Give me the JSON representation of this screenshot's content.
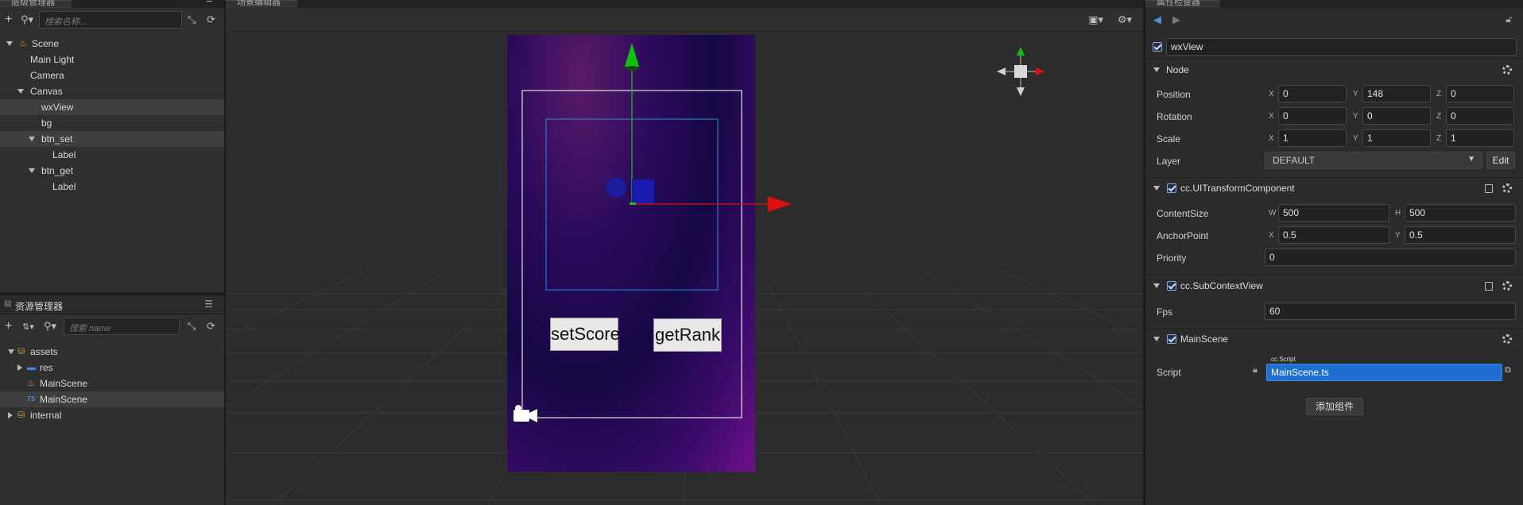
{
  "hierarchy": {
    "title": "层级管理器",
    "search_placeholder": "搜索名称...",
    "nodes": [
      {
        "label": "Scene",
        "icon": "scene-flame-icon",
        "expanded": true,
        "depth": 0
      },
      {
        "label": "Main Light",
        "depth": 1
      },
      {
        "label": "Camera",
        "depth": 1
      },
      {
        "label": "Canvas",
        "expanded": true,
        "depth": 1
      },
      {
        "label": "wxView",
        "depth": 2,
        "selected": true
      },
      {
        "label": "bg",
        "depth": 2
      },
      {
        "label": "btn_set",
        "expanded": true,
        "depth": 2,
        "highlight": true
      },
      {
        "label": "Label",
        "depth": 3
      },
      {
        "label": "btn_get",
        "expanded": true,
        "depth": 2
      },
      {
        "label": "Label",
        "depth": 3
      }
    ]
  },
  "assets": {
    "title": "资源管理器",
    "search_placeholder": "搜索 name",
    "nodes": [
      {
        "label": "assets",
        "icon": "database-icon",
        "expanded": true
      },
      {
        "label": "res",
        "icon": "folder-icon"
      },
      {
        "label": "MainScene",
        "icon": "scene-flame-icon"
      },
      {
        "label": "MainScene",
        "icon": "ts-icon",
        "selected": true
      },
      {
        "label": "internal",
        "icon": "database-icon"
      }
    ],
    "ts_badge": "TS"
  },
  "scene": {
    "title": "场景编辑器",
    "buttons": {
      "set_score": "setScore",
      "get_rank": "getRank"
    }
  },
  "inspector": {
    "title": "属性检查器",
    "node_name": "wxView",
    "node_section": "Node",
    "position": {
      "label": "Position",
      "x": "0",
      "y": "148",
      "z": "0"
    },
    "rotation": {
      "label": "Rotation",
      "x": "0",
      "y": "0",
      "z": "0"
    },
    "scale": {
      "label": "Scale",
      "x": "1",
      "y": "1",
      "z": "1"
    },
    "layer": {
      "label": "Layer",
      "value": "DEFAULT",
      "edit": "Edit"
    },
    "ui_transform": {
      "title": "cc.UITransformComponent",
      "content_size": {
        "label": "ContentSize",
        "w": "500",
        "h": "500"
      },
      "anchor_point": {
        "label": "AnchorPoint",
        "x": "0.5",
        "y": "0.5"
      },
      "priority": {
        "label": "Priority",
        "value": "0"
      }
    },
    "sub_context": {
      "title": "cc.SubContextView",
      "fps_label": "Fps",
      "fps": "60"
    },
    "main_scene": {
      "title": "MainScene",
      "script_label": "Script",
      "script_type": "cc.Script",
      "script_value": "MainScene.ts"
    },
    "add_component": "添加组件",
    "axis": {
      "x": "X",
      "y": "Y",
      "z": "Z",
      "w": "W",
      "h": "H"
    }
  },
  "colors": {
    "selection_blue": "#1e6fd0",
    "accent_arrow_red": "#e01010",
    "accent_arrow_green": "#10c010"
  }
}
